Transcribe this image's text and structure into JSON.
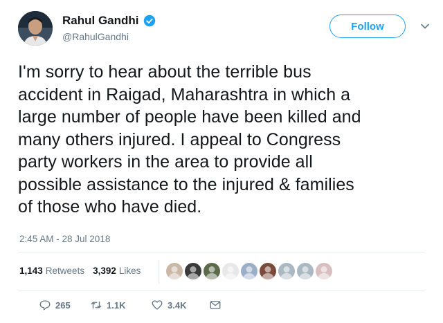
{
  "user": {
    "display_name": "Rahul Gandhi",
    "handle": "@RahulGandhi",
    "verified": true
  },
  "follow_button": {
    "label": "Follow"
  },
  "tweet": {
    "lines": [
      "I'm sorry to hear about the terrible bus",
      "accident in Raigad, Maharashtra in which a",
      "large number of people have been killed and",
      "many others injured. I appeal to Congress",
      "party workers in the area to provide all",
      "possible assistance to the injured & families",
      "of those who have died."
    ],
    "timestamp": "2:45 AM - 28 Jul 2018"
  },
  "stats": {
    "retweets_count": "1,143",
    "retweets_label": "Retweets",
    "likes_count": "3,392",
    "likes_label": "Likes"
  },
  "liker_avatars": [
    "#c9b8a6",
    "#3a3a3a",
    "#5b6b4a",
    "#e8e8e8",
    "#9bb0c8",
    "#7a4a3a",
    "#aab8c2",
    "#aab8c2",
    "#d9c0c0"
  ],
  "actions": {
    "reply_count": "265",
    "retweet_count": "1.1K",
    "like_count": "3.4K"
  },
  "colors": {
    "accent": "#1da1f2",
    "muted": "#657786",
    "text": "#14171a"
  },
  "icons": [
    "verified-badge-icon",
    "chevron-down-icon",
    "reply-icon",
    "retweet-icon",
    "heart-icon",
    "direct-message-icon"
  ]
}
